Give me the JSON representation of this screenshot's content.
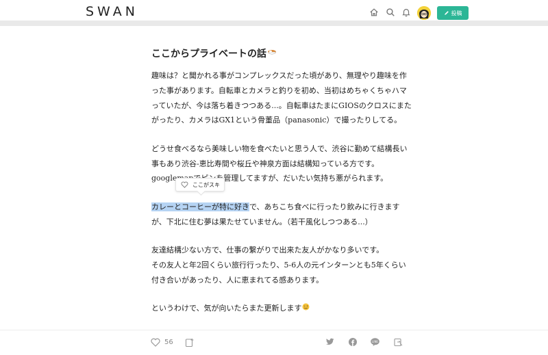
{
  "header": {
    "logo": "SWAN",
    "icons": [
      "home-icon",
      "search-icon",
      "bell-icon"
    ],
    "post_button_label": "投稿"
  },
  "article": {
    "title": "ここからプライベートの話",
    "paragraphs": [
      [
        "趣味は？と聞かれる事がコンプレックスだった頃があり、無理やり趣味を作",
        "った事があります。自転車とカメラと釣りを初め、当初はめちゃくちゃハマ",
        "っていたが、今は落ち着きつつある...。自転車はたまにGIOSのクロスにまた",
        "がったり、カメラはGX1という骨董品（panasonic）で撮ったりしてる。"
      ],
      [
        "どうせ食べるなら美味しい物を食べたいと思う人で、渋谷に勤めて結構長い",
        "事もあり渋谷-恵比寿間や桜丘や神泉方面は結構知っている方です。",
        "googlemapでピンを管理してますが、だいたい気持ち悪がられます。"
      ],
      [
        "カレーとコーヒーが特に好きで、あちこち食べに行ったり飲みに行きます",
        "が、下北に住む夢は果たせていません。（若干風化しつつある...）"
      ],
      [
        "友達結構少ない方で、仕事の繋がりで出来た友人がかなり多いです。",
        "その友人と年2回くらい旅行行ったり、5-6人の元インターンとも5年くらい",
        "付き合いがあったり、人に恵まれてる感あります。"
      ],
      [
        "というわけで、気が向いたらまた更新します"
      ]
    ],
    "highlight": {
      "selected": "カレーとコーヒーが特に好き",
      "rest": "で、あちこち食べに行ったり飲みに行きます"
    }
  },
  "tooltip": {
    "label": "ここがスキ"
  },
  "footer": {
    "like_count": "56",
    "icons": [
      "heart-icon",
      "magazine-add-icon",
      "twitter-icon",
      "facebook-icon",
      "line-icon",
      "embed-icon"
    ]
  },
  "colors": {
    "accent": "#2cb696",
    "highlight": "#b5d3f3"
  }
}
